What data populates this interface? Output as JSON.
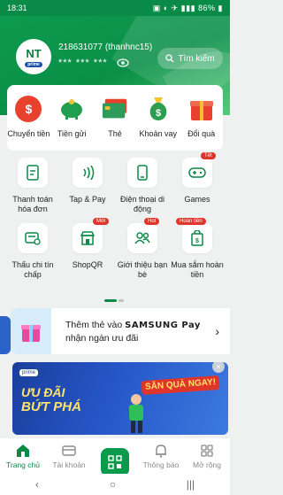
{
  "status_bar": {
    "time": "18:31",
    "indicators": "86%"
  },
  "header": {
    "avatar_initials": "NT",
    "avatar_badge": "prime",
    "account": "218631077 (thanhnc15)",
    "masked_balance": "*** *** ***",
    "search_label": "Tìm kiếm"
  },
  "quick_actions": [
    {
      "label": "Chuyển tiền",
      "icon": "dollar-circle-icon",
      "color": "#e8422e"
    },
    {
      "label": "Tiền gửi",
      "icon": "piggy-bank-icon",
      "color": "#1f9e4d"
    },
    {
      "label": "Thẻ",
      "icon": "card-icon",
      "color": "#2e9b5a"
    },
    {
      "label": "Khoản vay",
      "icon": "money-bag-icon",
      "color": "#2c9e4f"
    },
    {
      "label": "Đổi quà",
      "icon": "gift-icon",
      "color": "#e8422e"
    }
  ],
  "services": [
    {
      "label": "Thanh toán hóa đơn",
      "icon": "bill-icon",
      "badge": ""
    },
    {
      "label": "Tap & Pay",
      "icon": "nfc-icon",
      "badge": ""
    },
    {
      "label": "Điện thoại di động",
      "icon": "phone-icon",
      "badge": ""
    },
    {
      "label": "Games",
      "icon": "gamepad-icon",
      "badge": "Tết"
    },
    {
      "label": "Thấu chi tín chấp",
      "icon": "overdraft-icon",
      "badge": ""
    },
    {
      "label": "ShopQR",
      "icon": "shop-icon",
      "badge": "Mới"
    },
    {
      "label": "Giới thiệu bạn bè",
      "icon": "users-icon",
      "badge": "Hot"
    },
    {
      "label": "Mua sắm hoàn tiền",
      "icon": "cashback-icon",
      "badge": "Hoàn tiền"
    }
  ],
  "promo": {
    "line1": "Thêm thẻ vào",
    "brand": "SAMSUNG Pay",
    "line2": "nhận ngàn ưu đãi"
  },
  "banner": {
    "badge": "prime",
    "headline1": "ƯU ĐÃI",
    "headline2": "BỨT PHÁ",
    "side": "SĂN QUÀ NGAY!"
  },
  "bottom_nav": [
    {
      "label": "Trang chủ",
      "icon": "home-icon",
      "active": true
    },
    {
      "label": "Tài khoản",
      "icon": "account-icon",
      "active": false
    },
    {
      "label": "",
      "icon": "qr-scan-icon",
      "active": false
    },
    {
      "label": "Thông báo",
      "icon": "bell-icon",
      "active": false
    },
    {
      "label": "Mở rộng",
      "icon": "grid-icon",
      "active": false
    }
  ],
  "colors": {
    "brand": "#0a8a47",
    "accent": "#e0352b"
  }
}
